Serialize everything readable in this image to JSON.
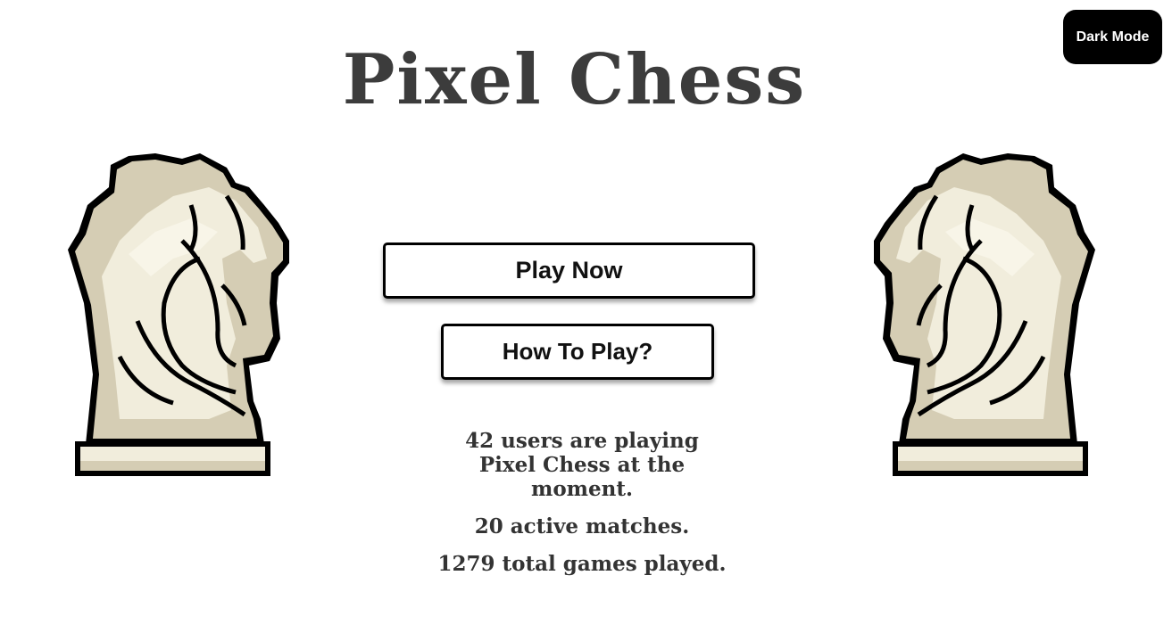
{
  "header": {
    "title": "Pixel Chess",
    "dark_mode_label": "Dark Mode"
  },
  "menu": {
    "play_label": "Play Now",
    "how_to_label": "How To Play?"
  },
  "stats": {
    "users_text": "42 users are playing Pixel Chess at the moment.",
    "matches_text": "20 active matches.",
    "games_text": "1279 total games played."
  },
  "icons": {
    "left": "knight-icon",
    "right": "knight-icon"
  },
  "colors": {
    "outline": "#000000",
    "knight_light": "#f1eddc",
    "knight_shade": "#d5cdb4",
    "title": "#3c3c3c"
  }
}
